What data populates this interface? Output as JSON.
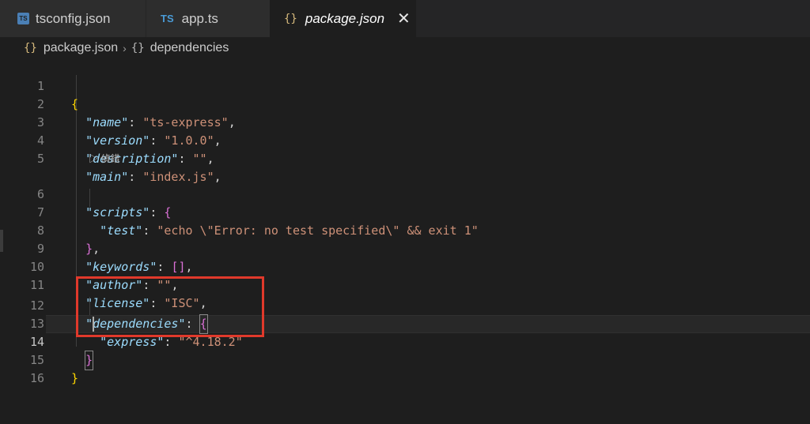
{
  "tabs": [
    {
      "label": "tsconfig.json",
      "icon": "ts-file-icon",
      "active": false
    },
    {
      "label": "app.ts",
      "icon": "ts-text-icon",
      "active": false
    },
    {
      "label": "package.json",
      "icon": "json-braces-icon",
      "active": true
    }
  ],
  "icons": {
    "ts_badge": "TS",
    "ts_text": "TS",
    "json_braces": "{}",
    "close": "✕",
    "chevron": "›",
    "run": "▷"
  },
  "breadcrumb": {
    "file": "package.json",
    "symbol": "dependencies"
  },
  "codelens": {
    "label": "偵錯"
  },
  "lines": {
    "n1": "1",
    "n2": "2",
    "n3": "3",
    "n4": "4",
    "n5": "5",
    "n6": "6",
    "n7": "7",
    "n8": "8",
    "n9": "9",
    "n10": "10",
    "n11": "11",
    "n12": "12",
    "n13": "13",
    "n14": "14",
    "n15": "15",
    "n16": "16"
  },
  "code": {
    "name_key": "\"name\"",
    "name_val": "\"ts-express\"",
    "version_key": "\"version\"",
    "version_val": "\"1.0.0\"",
    "description_key": "\"description\"",
    "description_val": "\"\"",
    "main_key": "\"main\"",
    "main_val": "\"index.js\"",
    "scripts_key": "\"scripts\"",
    "test_key": "\"test\"",
    "test_val": "\"echo \\\"Error: no test specified\\\" && exit 1\"",
    "keywords_key": "\"keywords\"",
    "author_key": "\"author\"",
    "author_val": "\"\"",
    "license_key": "\"license\"",
    "license_val": "\"ISC\"",
    "dependencies_key": "\"dependencies\"",
    "express_key": "\"express\"",
    "express_val": "\"^4.18.2\""
  },
  "colors": {
    "highlight_box": "#e0392b",
    "key": "#9cdcfe",
    "string": "#ce9178",
    "bracket_gold": "#ffd700",
    "bracket_pink": "#da70d6",
    "bracket_blue": "#179fff"
  }
}
